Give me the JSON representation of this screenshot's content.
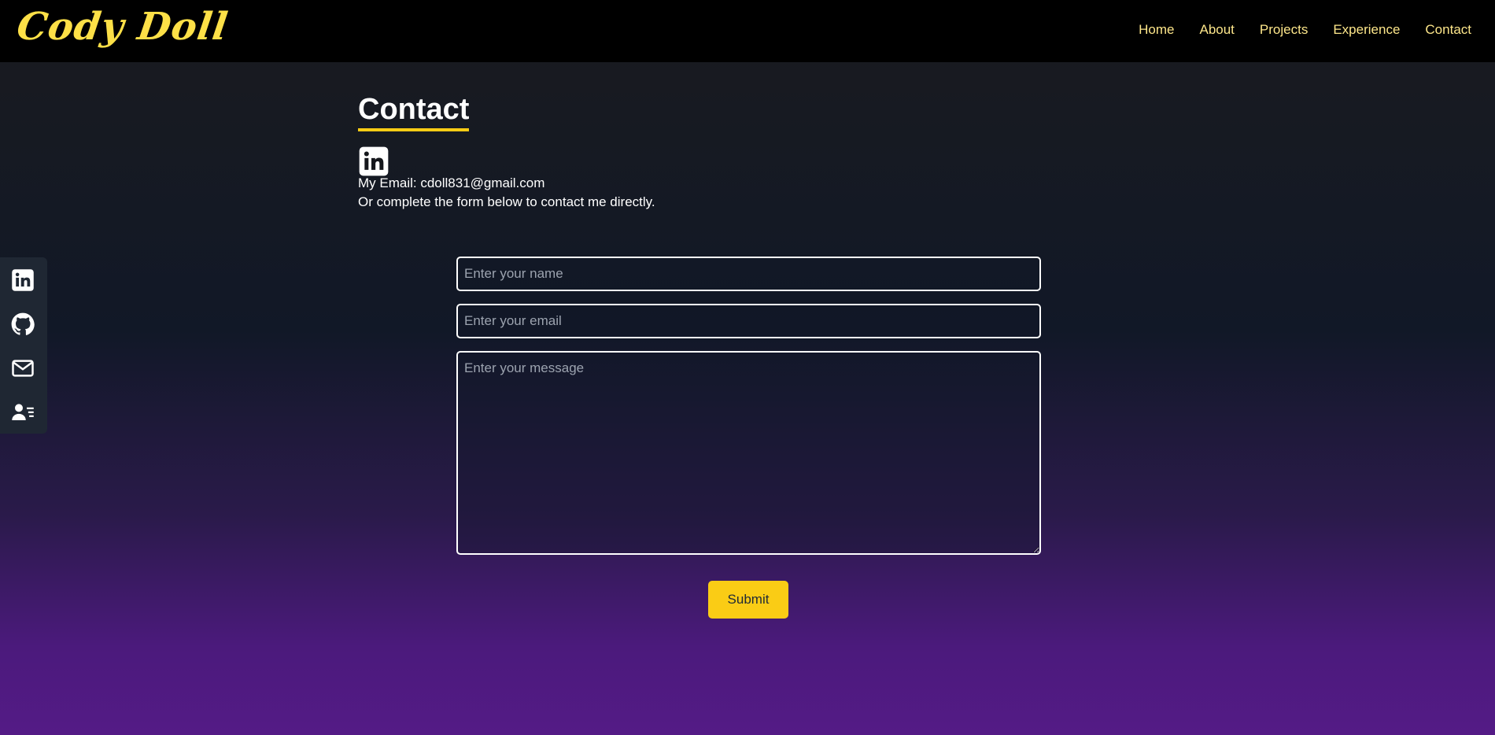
{
  "header": {
    "logo": "Cody Doll",
    "nav": [
      "Home",
      "About",
      "Projects",
      "Experience",
      "Contact"
    ]
  },
  "contact": {
    "title": "Contact",
    "linkedin_icon": "linkedin-icon",
    "email_line": "My Email: cdoll831@gmail.com",
    "form_prompt": "Or complete the form below to contact me directly."
  },
  "sidebar": {
    "icons": [
      "linkedin-icon",
      "github-icon",
      "mail-icon",
      "resume-icon"
    ]
  },
  "form": {
    "name_placeholder": "Enter your name",
    "email_placeholder": "Enter your email",
    "message_placeholder": "Enter your message",
    "submit_label": "Submit"
  },
  "colors": {
    "accent": "#facc15",
    "nav_text": "#fde68a",
    "topbar": "#000000"
  }
}
